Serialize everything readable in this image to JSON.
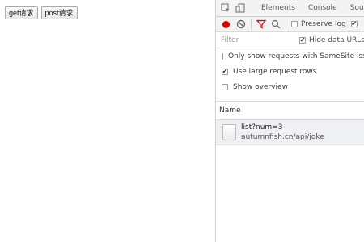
{
  "page": {
    "buttons": [
      {
        "label": "get请求"
      },
      {
        "label": "post请求"
      }
    ]
  },
  "devtools": {
    "tabs": [
      "Elements",
      "Console",
      "Sources"
    ],
    "toolbar": {
      "preserve_log_label": "Preserve log",
      "preserve_log_checked": false,
      "disable_cache_checked": true
    },
    "filter": {
      "placeholder": "Filter",
      "hide_data_label": "Hide data URLs",
      "hide_data_checked": true
    },
    "options": [
      {
        "label": "Only show requests with SameSite issues",
        "checked": false
      },
      {
        "label": "Use large request rows",
        "checked": true
      },
      {
        "label": "Show overview",
        "checked": false
      }
    ],
    "table": {
      "column_name": "Name",
      "rows": [
        {
          "name": "list?num=3",
          "domain": "autumnfish.cn/api/joke"
        }
      ]
    },
    "colors": {
      "record": "#d50000",
      "filter_icon": "#d50000",
      "selected_row": "#eef0f3"
    }
  }
}
